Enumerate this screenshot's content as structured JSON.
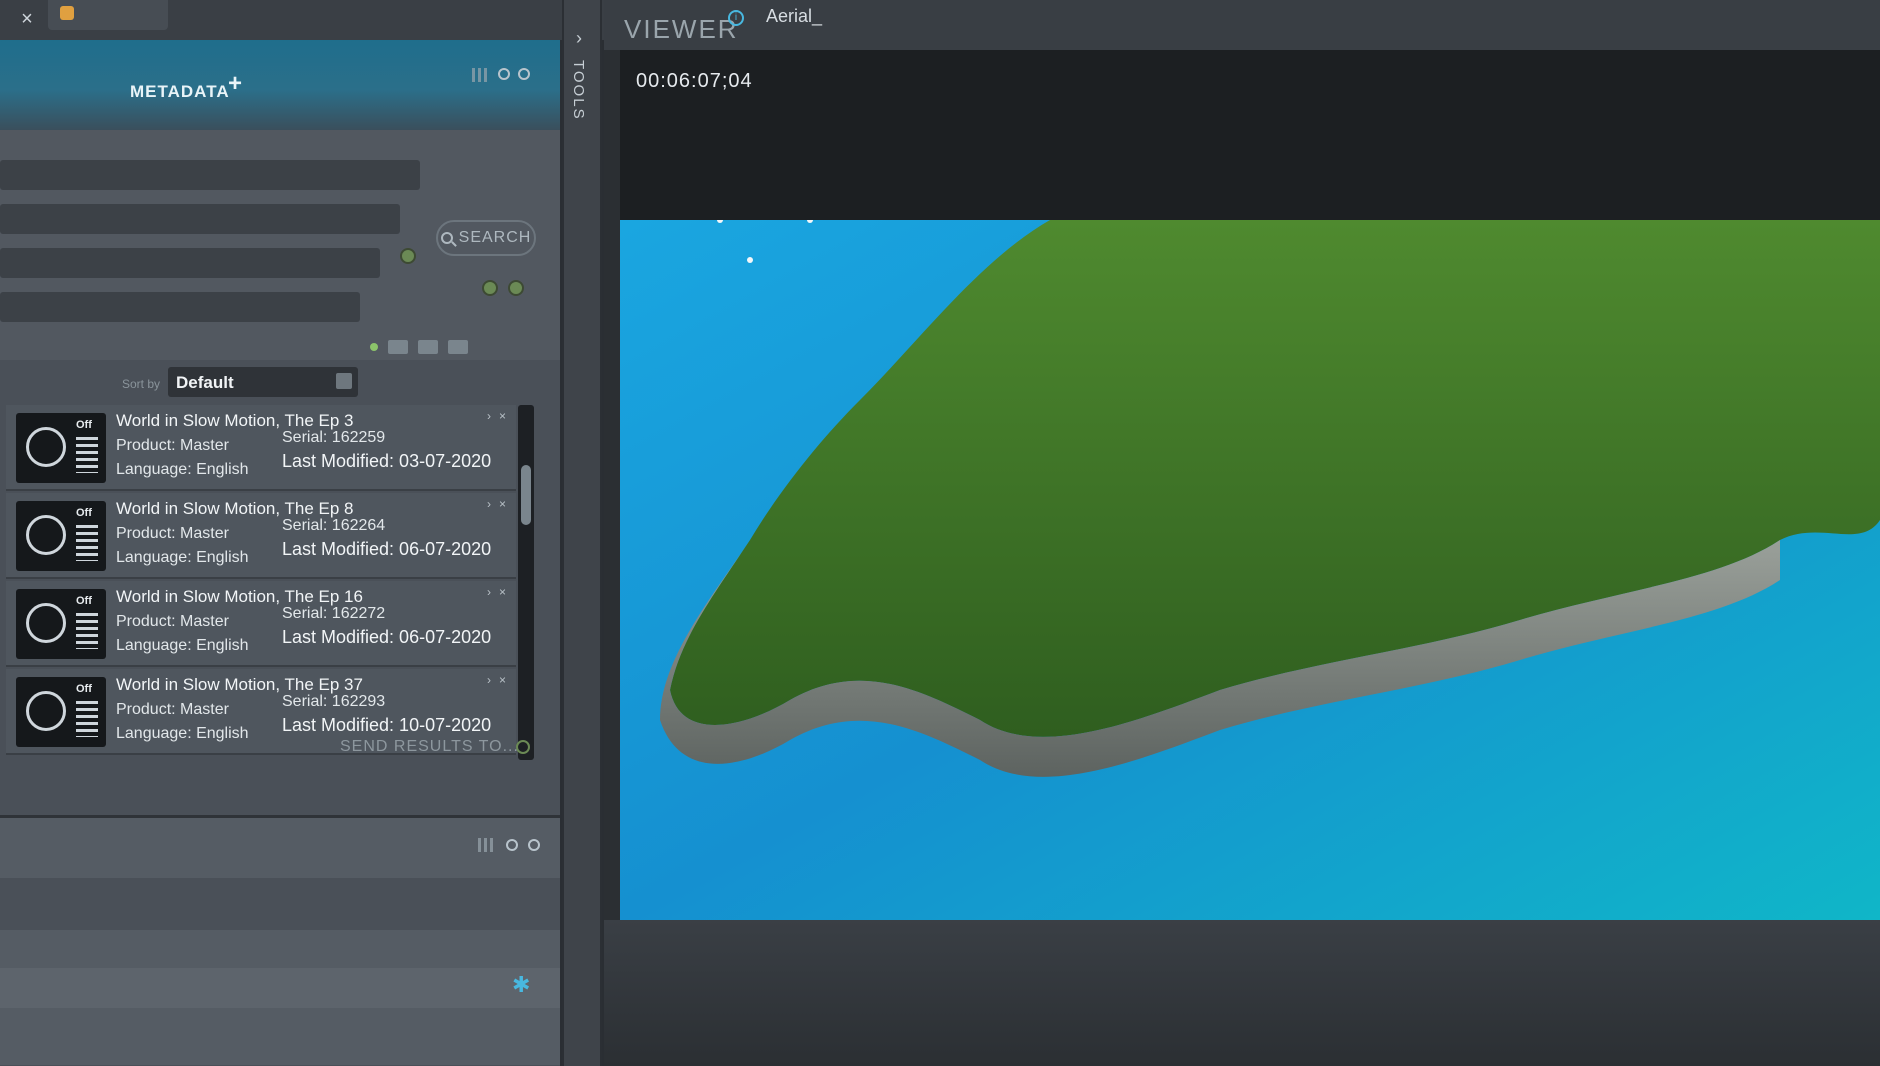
{
  "topbar": {
    "close_label": "×"
  },
  "metadata_panel": {
    "title": "METADATA",
    "add_label": "+",
    "search_button": "SEARCH",
    "sort_by_label": "Sort by",
    "sort_value": "Default",
    "send_results_label": "SEND RESULTS TO..."
  },
  "results": [
    {
      "title": "World in Slow Motion, The Ep 3",
      "thumb_label": "Off",
      "product": "Product: Master",
      "language": "Language: English",
      "serial": "Serial: 162259",
      "modified": "Last Modified: 03-07-2020"
    },
    {
      "title": "World in Slow Motion, The Ep 8",
      "thumb_label": "Off",
      "product": "Product: Master",
      "language": "Language: English",
      "serial": "Serial: 162264",
      "modified": "Last Modified: 06-07-2020"
    },
    {
      "title": "World in Slow Motion, The Ep 16",
      "thumb_label": "Off",
      "product": "Product: Master",
      "language": "Language: English",
      "serial": "Serial: 162272",
      "modified": "Last Modified: 06-07-2020"
    },
    {
      "title": "World in Slow Motion, The Ep 37",
      "thumb_label": "Off",
      "product": "Product: Master",
      "language": "Language: English",
      "serial": "Serial: 162293",
      "modified": "Last Modified: 10-07-2020"
    }
  ],
  "tools": {
    "label": "TOOLS",
    "chevron": "›"
  },
  "viewer": {
    "title": "VIEWER",
    "info_icon": "i",
    "clip_name": "Aerial_",
    "timecode": "00:06:07;04"
  },
  "icons": [
    "close-icon",
    "plus-icon",
    "search-icon",
    "info-icon",
    "gear-icon",
    "chevron-right-icon"
  ],
  "colors": {
    "accent": "#1f6e8c",
    "highlight": "#48b8e0",
    "ok": "#8cc46a"
  }
}
